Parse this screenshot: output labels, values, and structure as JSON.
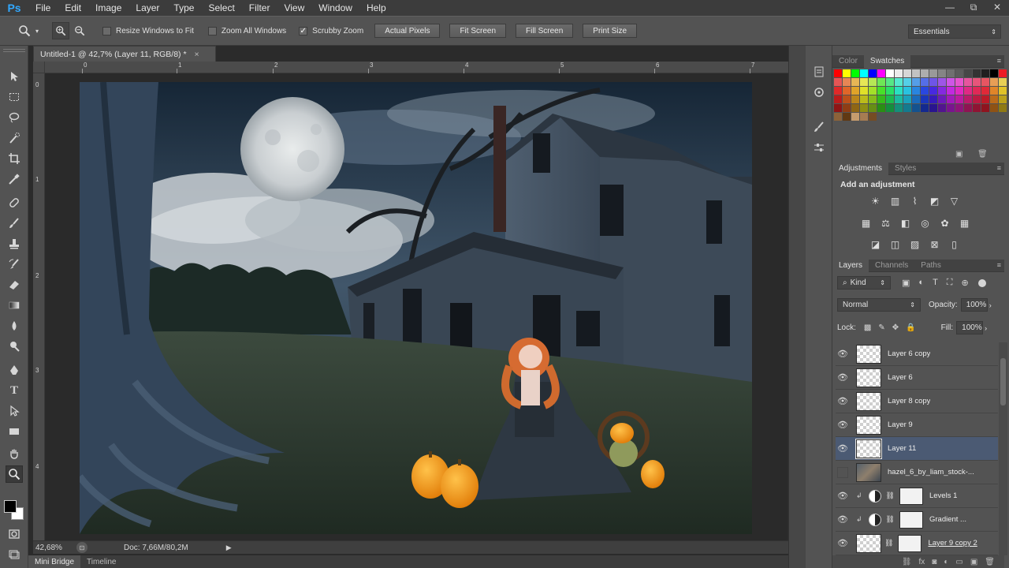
{
  "app": {
    "logo": "Ps"
  },
  "menu": [
    "File",
    "Edit",
    "Image",
    "Layer",
    "Type",
    "Select",
    "Filter",
    "View",
    "Window",
    "Help"
  ],
  "window_controls": {
    "minimize": "—",
    "restore": "⧉",
    "close": "✕"
  },
  "options": {
    "resize_windows": {
      "label": "Resize Windows to Fit",
      "checked": false
    },
    "zoom_all_windows": {
      "label": "Zoom All Windows",
      "checked": false
    },
    "scrubby_zoom": {
      "label": "Scrubby Zoom",
      "checked": true
    },
    "buttons": [
      "Actual Pixels",
      "Fit Screen",
      "Fill Screen",
      "Print Size"
    ],
    "workspace": "Essentials"
  },
  "document": {
    "tab_title": "Untitled-1 @ 42,7% (Layer 11, RGB/8) *",
    "zoom": "42,68%",
    "doc_size": "Doc: 7,66M/80,2M",
    "ruler_top_ticks": [
      "0",
      "1",
      "2",
      "3",
      "4",
      "5",
      "6",
      "7"
    ],
    "ruler_left_ticks": [
      "0",
      "1",
      "2",
      "3",
      "4"
    ]
  },
  "bottom_tabs": [
    "Mini Bridge",
    "Timeline"
  ],
  "panels": {
    "color_tabs": [
      "Color",
      "Swatches"
    ],
    "adjustment_tabs": [
      "Adjustments",
      "Styles"
    ],
    "adjustment_title": "Add an adjustment",
    "layer_tabs": [
      "Layers",
      "Channels",
      "Paths"
    ],
    "kind": "Kind",
    "blend_mode": "Normal",
    "opacity_label": "Opacity:",
    "opacity": "100%",
    "lock_label": "Lock:",
    "fill_label": "Fill:",
    "fill": "100%"
  },
  "layers": [
    {
      "name": "Layer 6 copy",
      "visible": true,
      "selected": false,
      "kind": "pixel"
    },
    {
      "name": "Layer 6",
      "visible": true,
      "selected": false,
      "kind": "pixel"
    },
    {
      "name": "Layer 8 copy",
      "visible": true,
      "selected": false,
      "kind": "pixel"
    },
    {
      "name": "Layer 9",
      "visible": true,
      "selected": false,
      "kind": "pixel"
    },
    {
      "name": "Layer 11",
      "visible": true,
      "selected": true,
      "kind": "pixel"
    },
    {
      "name": "hazel_6_by_liam_stock-...",
      "visible": false,
      "selected": false,
      "kind": "photo"
    },
    {
      "name": "Levels 1",
      "visible": true,
      "selected": false,
      "kind": "adjustment"
    },
    {
      "name": "Gradient ...",
      "visible": true,
      "selected": false,
      "kind": "adjustment"
    },
    {
      "name": "Layer 9 copy 2",
      "visible": true,
      "selected": false,
      "kind": "masked"
    }
  ],
  "colors": {
    "accent": "#31a8ff",
    "selected_layer": "#4b5a73"
  }
}
